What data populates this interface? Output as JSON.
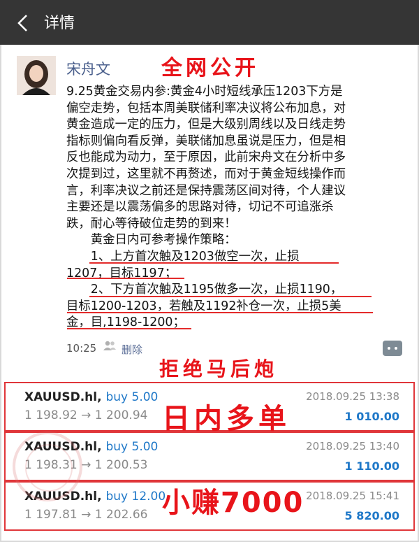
{
  "header": {
    "title": "详情"
  },
  "post": {
    "author": "宋舟文",
    "lines": [
      "9.25黄金交易内参:黄金4小时短线承压1203下方是",
      "偏空走势，包括本周美联储利率决议将公布加息，对",
      "黄金造成一定的压力，但是大级别周线以及日线走势",
      "指标则偏向看反弹，美联储加息虽说是压力，但是相",
      "反也能成为动力，至于原因，此前宋舟文在分析中多",
      "次提到过，这里就不再赘述，而对于黄金短线操作而",
      "言，利率决议之前还是保持震荡区间对待，个人建议",
      "主要还是以震荡偏多的思路对待，切记不可追涨杀",
      "跌，耐心等待破位走势的到来！",
      "　　黄金日内可参考操作策略：",
      "　　1、上方首次触及1203做空一次，止损",
      "1207，目标1197；",
      "　　2、下方首次触及1195做多一次，止损1190，",
      "目标1200-1203，若触及1192补仓一次，止损5美",
      "金，目,1198-1200；"
    ],
    "time": "10:25",
    "delete_label": "删除"
  },
  "overlays": {
    "public": "全网公开",
    "no_hindsight": "拒绝马后炮",
    "intraday_long": "日内多单",
    "small_profit": "小赚7000"
  },
  "trades": [
    {
      "symbol": "XAUUSD.hl,",
      "side": "buy 5.00",
      "prices": "1 198.92 → 1 200.94",
      "datetime": "2018.09.25 13:38",
      "profit": "1 010.00"
    },
    {
      "symbol": "XAUUSD.hl,",
      "side": "buy 5.00",
      "prices": "1 198.31 → 1 200.53",
      "datetime": "2018.09.25 13:40",
      "profit": "1 110.00"
    },
    {
      "symbol": "XAUUSD.hl,",
      "side": "buy 12.00",
      "prices": "1 197.81 → 1 202.66",
      "datetime": "2018.09.25 15:41",
      "profit": "5 820.00"
    }
  ],
  "colors": {
    "header_bg": "#353535",
    "stamp_red": "#e8141a",
    "buy_blue": "#1f78c8",
    "name_blue": "#4a5f8c"
  }
}
